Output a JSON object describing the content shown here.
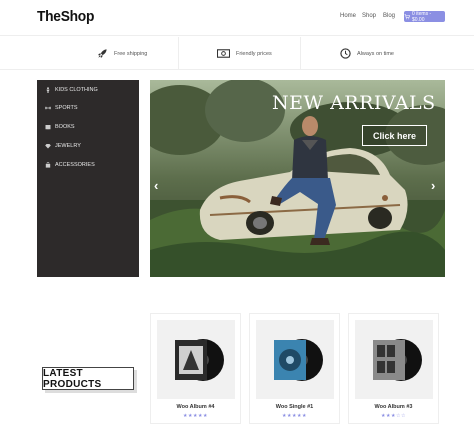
{
  "header": {
    "logo": "TheShop",
    "nav": [
      "Home",
      "Shop",
      "Blog"
    ],
    "cart_label": "0 items - $0.00"
  },
  "features": [
    {
      "label": "Free shipping",
      "icon": "rocket-icon"
    },
    {
      "label": "Friendly prices",
      "icon": "money-icon"
    },
    {
      "label": "Always on time",
      "icon": "clock-icon"
    }
  ],
  "sidebar": {
    "items": [
      {
        "label": "KIDS CLOTHING",
        "icon": "child-icon"
      },
      {
        "label": "SPORTS",
        "icon": "dumbbell-icon"
      },
      {
        "label": "BOOKS",
        "icon": "book-icon"
      },
      {
        "label": "JEWELRY",
        "icon": "diamond-icon"
      },
      {
        "label": "ACCESSORIES",
        "icon": "bag-icon"
      }
    ]
  },
  "hero": {
    "title": "NEW ARRIVALS",
    "button_label": "Click here",
    "prev": "‹",
    "next": "›"
  },
  "section": {
    "title": "LATEST PRODUCTS"
  },
  "products": [
    {
      "name": "Woo Album #4",
      "stars": "★★★★★",
      "rating": 5,
      "cover_color": "#2a2a2a"
    },
    {
      "name": "Woo Single #1",
      "stars": "★★★★★",
      "rating": 5,
      "cover_color": "#3b84b0"
    },
    {
      "name": "Woo Album #3",
      "stars": "★★★☆☆",
      "rating": 3,
      "cover_color": "#8a8a8a"
    }
  ],
  "colors": {
    "accent": "#8b8fe3",
    "sidebar_bg": "#2d2a2a"
  }
}
